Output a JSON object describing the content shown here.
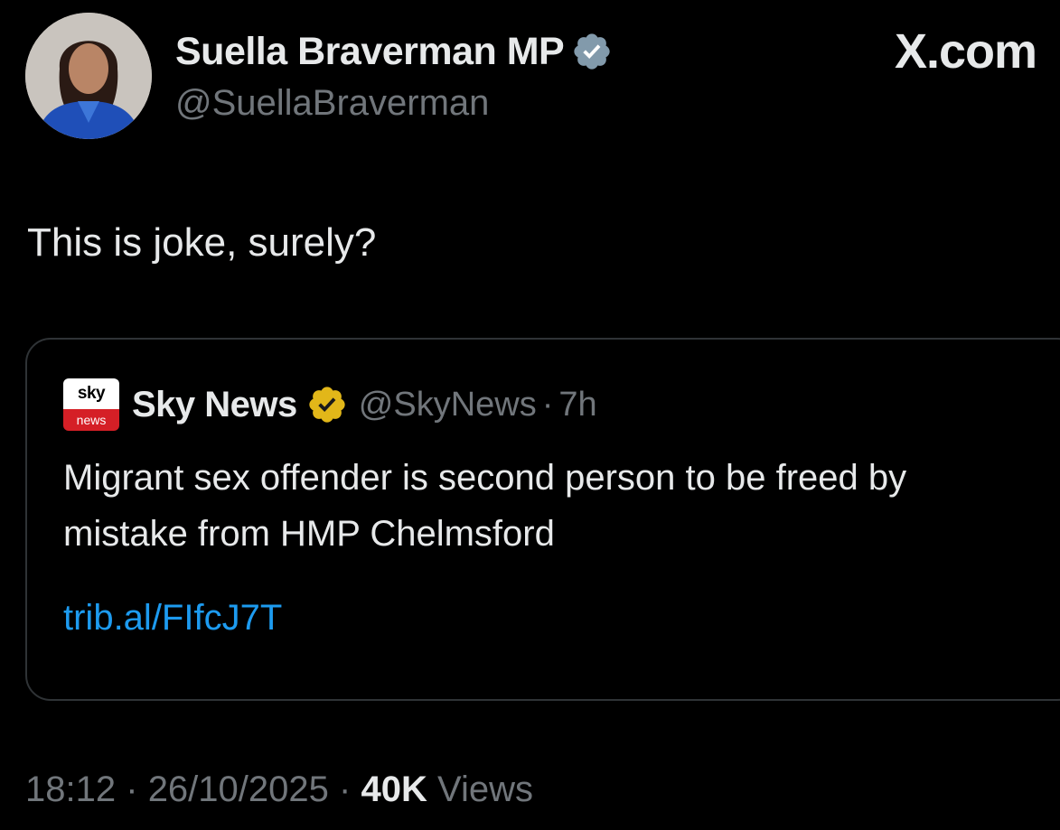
{
  "author": {
    "name": "Suella Braverman MP",
    "handle": "@SuellaBraverman",
    "verified_badge": "gray-verified-icon",
    "badge_color": "#829aab"
  },
  "brand": {
    "label": "X.com"
  },
  "tweet": {
    "text": "This is joke, surely?"
  },
  "quoted": {
    "logo_text_top": "sky",
    "logo_text_bottom": "news",
    "name": "Sky News",
    "verified_badge": "gold-verified-icon",
    "badge_color": "#e2b719",
    "handle": "@SkyNews",
    "separator": "·",
    "age": "7h",
    "text": "Migrant sex offender is second person to be freed by mistake from HMP Chelmsford",
    "link": "trib.al/FIfcJ7T"
  },
  "meta": {
    "time": "18:12",
    "separator": "·",
    "date": "26/10/2025",
    "views_count": "40K",
    "views_label": "Views"
  },
  "colors": {
    "background": "#000000",
    "primary_text": "#e7e9ea",
    "secondary_text": "#71767b",
    "link": "#1d9bf0",
    "border": "#2f3336"
  }
}
